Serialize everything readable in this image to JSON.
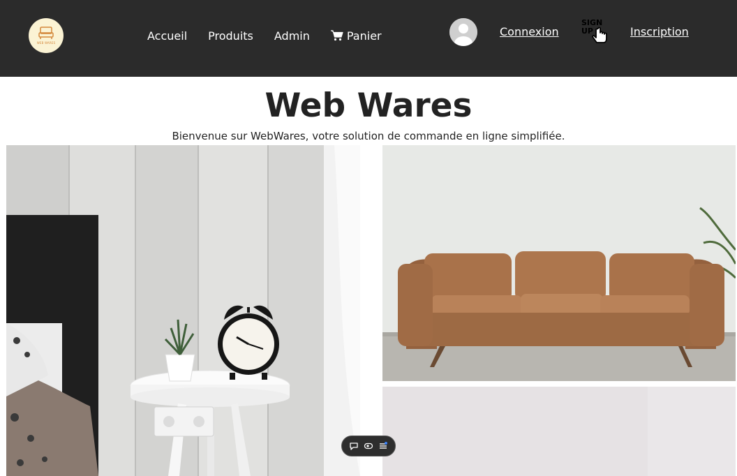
{
  "header": {
    "logo_text": "WEB WARES",
    "nav": [
      {
        "label": "Accueil",
        "icon": null
      },
      {
        "label": "Produits",
        "icon": null
      },
      {
        "label": "Admin",
        "icon": null
      },
      {
        "label": "Panier",
        "icon": "cart-icon"
      }
    ],
    "login_label": "Connexion",
    "signup_icon_text_1": "SIGN",
    "signup_icon_text_2": "UP",
    "register_label": "Inscription"
  },
  "main": {
    "title": "Web Wares",
    "tagline": "Bienvenue sur WebWares, votre solution de commande en ligne simplifiée."
  },
  "colors": {
    "navbar_bg": "#2b2b2b",
    "logo_bg": "#fbf3d4",
    "logo_accent": "#d3873a",
    "text_dark": "#222222",
    "sofa_leather": "#a9724a"
  },
  "toolbar": {
    "icons": [
      "comment-icon",
      "eye-icon",
      "menu-icon"
    ]
  }
}
